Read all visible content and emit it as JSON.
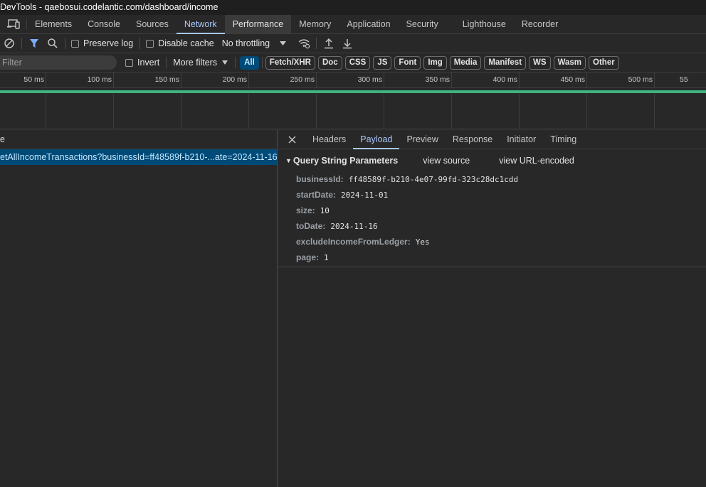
{
  "window": {
    "title": "DevTools - qaebosui.codelantic.com/dashboard/income"
  },
  "panel_tabs": [
    {
      "label": "Elements"
    },
    {
      "label": "Console"
    },
    {
      "label": "Sources"
    },
    {
      "label": "Network"
    },
    {
      "label": "Performance"
    },
    {
      "label": "Memory"
    },
    {
      "label": "Application"
    },
    {
      "label": "Security"
    },
    {
      "label": "Lighthouse"
    },
    {
      "label": "Recorder"
    }
  ],
  "active_panel": "Network",
  "toolbar": {
    "preserve_log_label": "Preserve log",
    "preserve_log_checked": false,
    "disable_cache_label": "Disable cache",
    "disable_cache_checked": false,
    "throttling_value": "No throttling",
    "icons": [
      "clear-icon",
      "filter-icon",
      "search-icon",
      "network-conditions-icon",
      "import-icon",
      "export-icon"
    ]
  },
  "filter_bar": {
    "placeholder": "Filter",
    "invert_label": "Invert",
    "more_filters_label": "More filters",
    "chips": [
      "All",
      "Fetch/XHR",
      "Doc",
      "CSS",
      "JS",
      "Font",
      "Img",
      "Media",
      "Manifest",
      "WS",
      "Wasm",
      "Other"
    ],
    "active_chip": "All"
  },
  "timeline": {
    "tick_labels": [
      "50 ms",
      "100 ms",
      "150 ms",
      "200 ms",
      "250 ms",
      "300 ms",
      "350 ms",
      "400 ms",
      "450 ms",
      "500 ms",
      "55"
    ]
  },
  "request_list": {
    "column_header": "e",
    "rows": [
      {
        "name": "etAllIncomeTransactions?businessId=ff48589f-b210-...ate=2024-11-16...",
        "selected": true
      }
    ]
  },
  "details": {
    "tabs": [
      "Headers",
      "Payload",
      "Preview",
      "Response",
      "Initiator",
      "Timing"
    ],
    "active_tab": "Payload",
    "section_title": "Query String Parameters",
    "view_source_label": "view source",
    "view_url_encoded_label": "view URL-encoded",
    "params": [
      {
        "key": "businessId:",
        "value": "ff48589f-b210-4e07-99fd-323c28dc1cdd"
      },
      {
        "key": "startDate:",
        "value": "2024-11-01"
      },
      {
        "key": "size:",
        "value": "10"
      },
      {
        "key": "toDate:",
        "value": "2024-11-16"
      },
      {
        "key": "excludeIncomeFromLedger:",
        "value": "Yes"
      },
      {
        "key": "page:",
        "value": "1"
      }
    ]
  },
  "colors": {
    "accent": "#a8c7fa",
    "selected_row": "#004a77",
    "waterfall_bar": "#3fb37f",
    "background": "#282828"
  }
}
